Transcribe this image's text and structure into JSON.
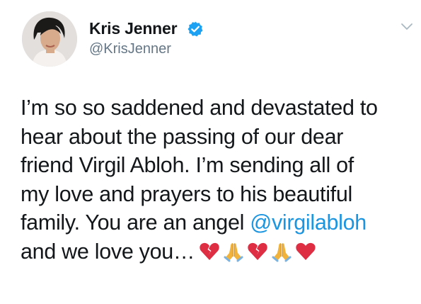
{
  "author": {
    "name": "Kris Jenner",
    "handle": "@KrisJenner",
    "verified": true
  },
  "tweet": {
    "lines": [
      "I’m so so saddened and devastated to",
      "hear about the passing of our dear",
      "friend Virgil Abloh. I’m sending all of",
      "my love and prayers to his beautiful"
    ],
    "line5_prefix": "family. You are an angel ",
    "mention": "@virgilabloh",
    "line6_text": "and we love you…",
    "emojis": [
      "broken-heart-icon",
      "folded-hands-icon",
      "broken-heart-icon",
      "folded-hands-icon",
      "red-heart-icon"
    ]
  },
  "colors": {
    "mention": "#1b95e0",
    "verified_badge": "#1da1f2",
    "handle": "#657786",
    "text": "#14171a"
  }
}
